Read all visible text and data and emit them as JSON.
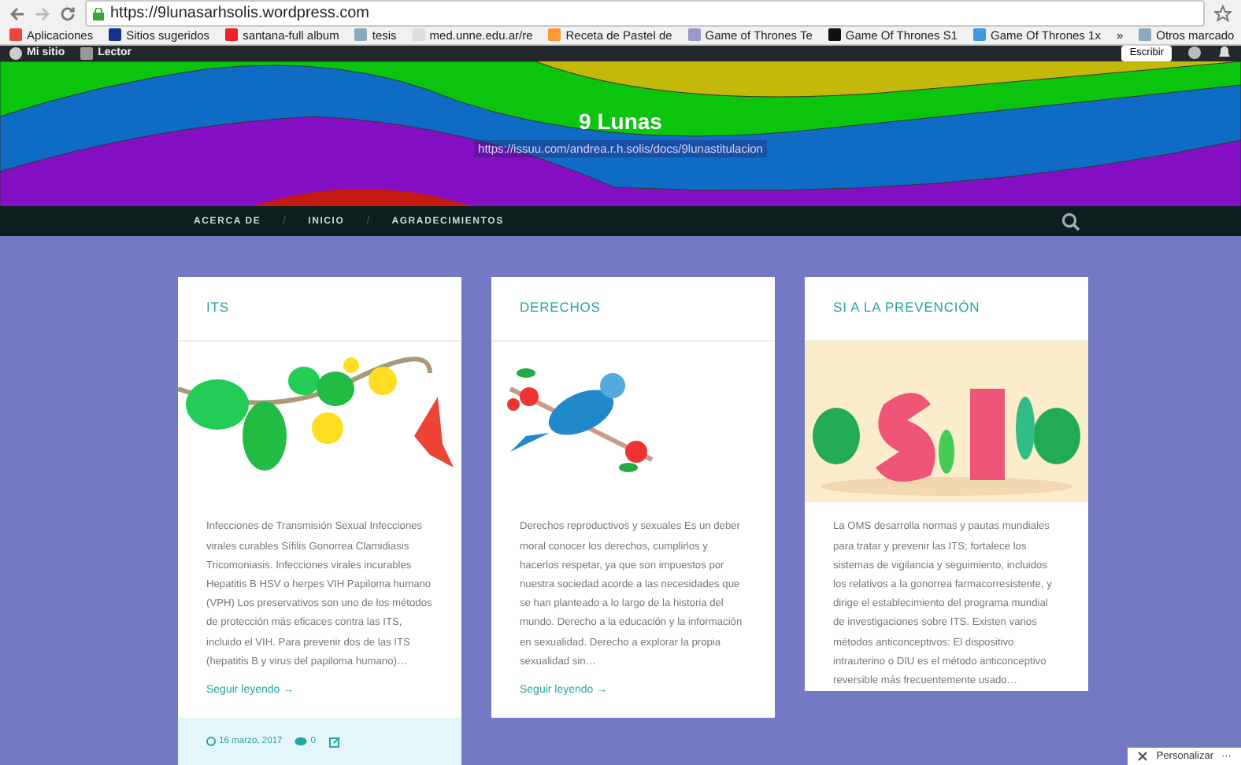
{
  "browser": {
    "url": "https://9lunasarhsolis.wordpress.com",
    "bookmarks": [
      {
        "label": "Aplicaciones",
        "kind": "apps"
      },
      {
        "label": "Sitios sugeridos",
        "kind": "bing"
      },
      {
        "label": "santana-full album",
        "kind": "video"
      },
      {
        "label": "tesis",
        "kind": "folder"
      },
      {
        "label": "med.unne.edu.ar/re",
        "kind": "page"
      },
      {
        "label": "Receta de Pastel de",
        "kind": "recipe"
      },
      {
        "label": "Game of Thrones Te",
        "kind": "u"
      },
      {
        "label": "Game Of Thrones S1",
        "kind": "dark"
      },
      {
        "label": "Game Of Thrones 1x",
        "kind": "bird"
      }
    ],
    "more": "»",
    "other": "Otros marcado"
  },
  "admin_bar": {
    "items": [
      {
        "label": "Mi sitio",
        "kind": "wp"
      },
      {
        "label": "Lector",
        "kind": "reader"
      }
    ],
    "write_button": "Escribir"
  },
  "site": {
    "title": "9 Lunas",
    "tagline": "https://issuu.com/andrea.r.h.solis/docs/9lunastitulacion"
  },
  "nav": {
    "items": [
      "ACERCA DE",
      "INICIO",
      "AGRADECIMIENTOS"
    ],
    "separator": "/"
  },
  "posts": [
    {
      "title": "ITS",
      "kind": "flowers",
      "excerpt": "Infecciones de Transmisión Sexual   Infecciones virales curables Sífilis Gonorrea Clamidiasis Tricomoniasis.    Infecciones virales incurables Hepatitis B HSV o herpes VIH Papiloma humano (VPH)   Los preservativos son uno de los métodos de protección más eficaces contra las ITS, incluido el VIH.   Para prevenir dos de las ITS (hepatitis B y virus del papiloma humano)…",
      "read_more": "Seguir leyendo →",
      "footer": {
        "date": "16 marzo, 2017",
        "comments": "0"
      }
    },
    {
      "title": "DERECHOS",
      "kind": "bird",
      "excerpt": "Derechos reproductivos y sexuales Es un deber moral conocer los derechos, cumplirlos y hacerlos respetar, ya que son impuestos por nuestra sociedad acorde a las necesidades que se han planteado a lo largo de la historia del mundo.   Derecho a la educación y la información en sexualidad. Derecho a explorar la propia sexualidad sin…",
      "read_more": "Seguir leyendo →"
    },
    {
      "title": "SI A LA PREVENCIÓN",
      "kind": "si",
      "excerpt": "La OMS desarrolla normas y pautas mundiales para tratar y prevenir las ITS; fortalece los sistemas de vigilancia y seguimiento, incluidos los relativos a la gonorrea farmacorresistente, y dirige el establecimiento del programa mundial de investigaciones sobre ITS. Existen varios métodos anticonceptivos:   El dispositivo intrauterino o DIU es el método anticonceptivo reversible más frecuentemente usado…"
    }
  ],
  "customize": {
    "label": "Personalizar",
    "more": "···"
  }
}
